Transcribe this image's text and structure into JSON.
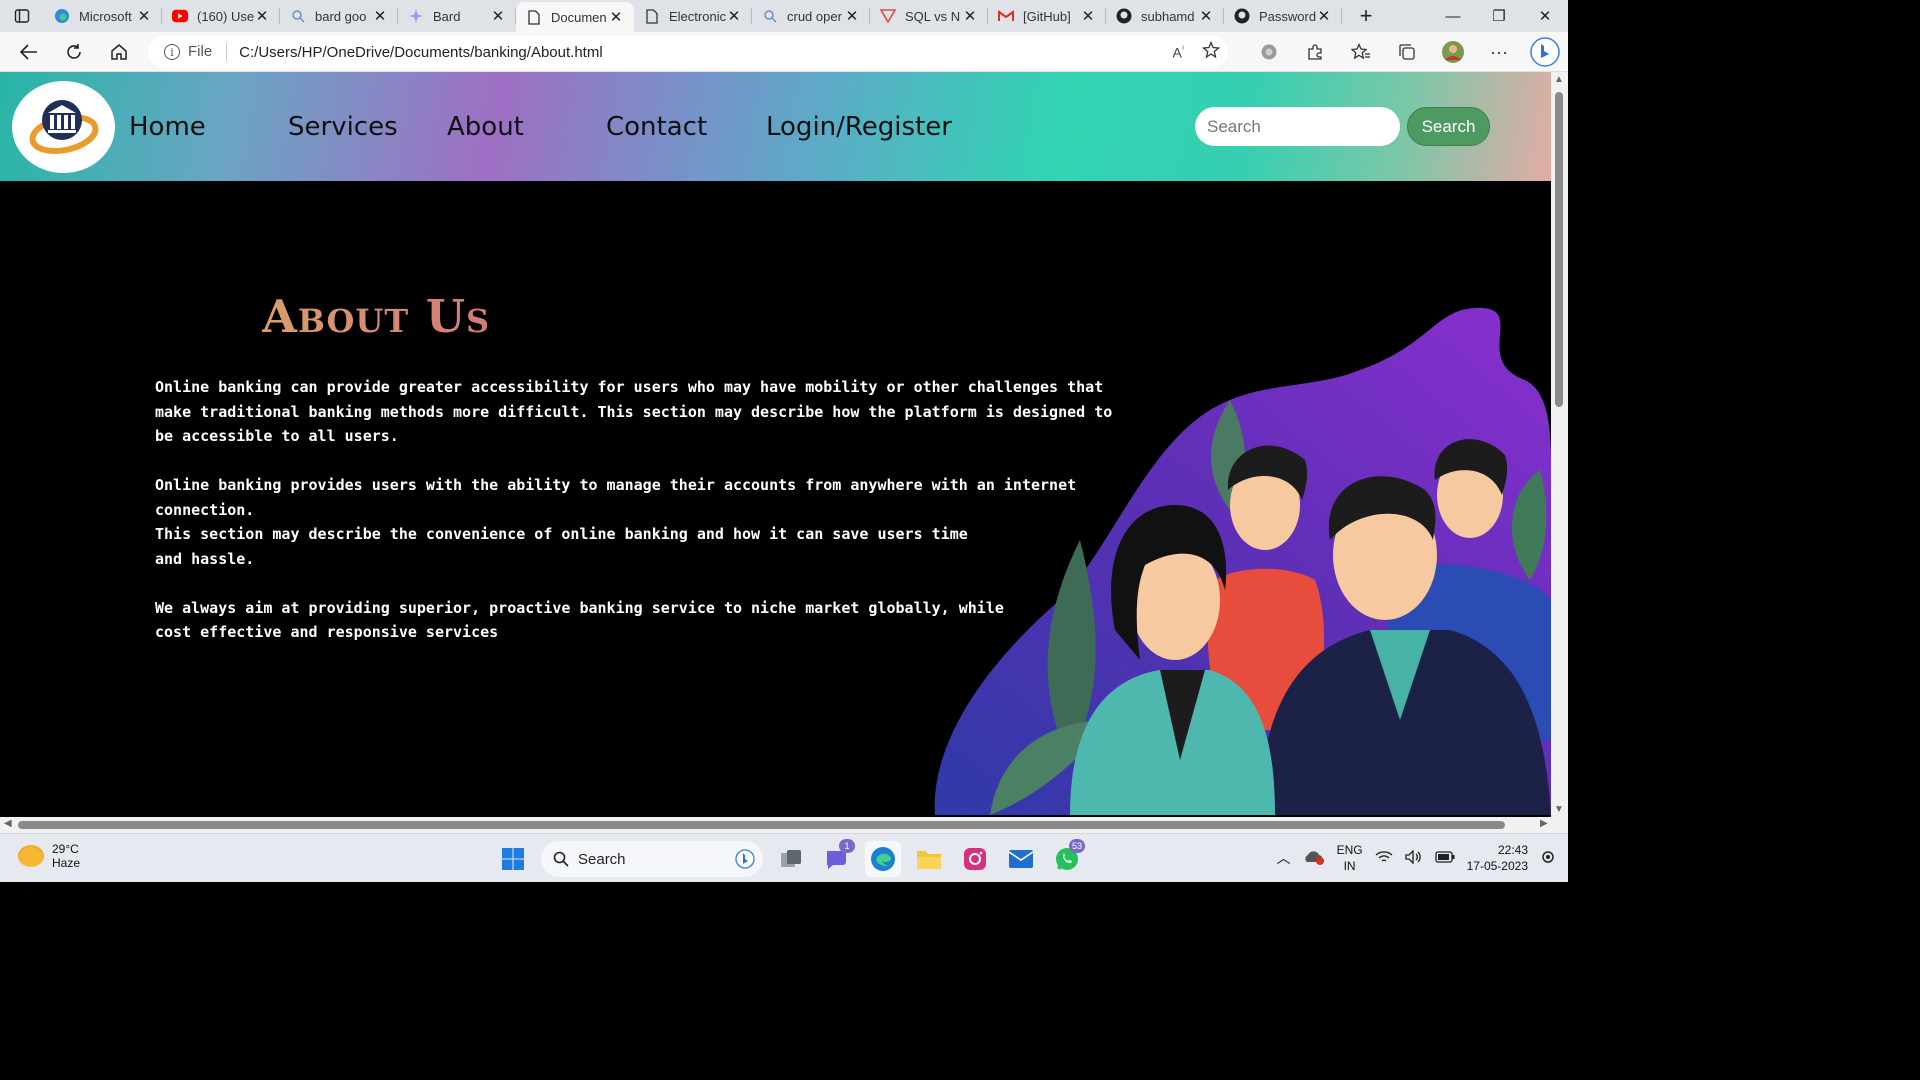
{
  "browser": {
    "tabs": [
      {
        "title": "Microsoft",
        "icon": "edge-icon"
      },
      {
        "title": "(160) Use",
        "icon": "youtube-icon"
      },
      {
        "title": "bard goo",
        "icon": "search-icon"
      },
      {
        "title": "Bard",
        "icon": "bard-icon"
      },
      {
        "title": "Documen",
        "icon": "document-icon",
        "active": true
      },
      {
        "title": "Electronic",
        "icon": "document-icon"
      },
      {
        "title": "crud oper",
        "icon": "search-icon"
      },
      {
        "title": "SQL vs N",
        "icon": "vercel-icon"
      },
      {
        "title": "[GitHub]",
        "icon": "gmail-icon"
      },
      {
        "title": "subhamd",
        "icon": "github-icon"
      },
      {
        "title": "Password",
        "icon": "github-icon"
      }
    ],
    "address": {
      "scheme_label": "File",
      "url": "C:/Users/HP/OneDrive/Documents/banking/About.html"
    }
  },
  "site": {
    "nav": {
      "home": "Home",
      "services": "Services",
      "about": "About",
      "contact": "Contact",
      "login": "Login/Register"
    },
    "search": {
      "placeholder": "Search",
      "button": "Search"
    },
    "about": {
      "title": "About Us",
      "para1": "Online banking can provide greater accessibility for users who may have mobility or other challenges that make traditional banking methods more difficult. This section may describe how the platform is designed to be accessible to all users.",
      "para2_line1": "Online banking provides users with the ability to manage their accounts from anywhere with an internet connection.",
      "para2_line2": "This section may describe the convenience of online banking and how it can save users time",
      "para2_line3": "and hassle.",
      "para3_line1": "We always aim at providing superior, proactive banking service to niche market globally, while",
      "para3_line2": "cost effective and responsive services"
    }
  },
  "taskbar": {
    "weather": {
      "temp": "29°C",
      "condition": "Haze"
    },
    "search_label": "Search",
    "teams_badge": "1",
    "whatsapp_badge": "53",
    "lang_line1": "ENG",
    "lang_line2": "IN",
    "time": "22:43",
    "date": "17-05-2023"
  },
  "colors": {
    "accent_green": "#4f9a63",
    "title_gold": "#d99e6a",
    "title_rose": "#d27a7a",
    "page_bg": "#000000"
  }
}
